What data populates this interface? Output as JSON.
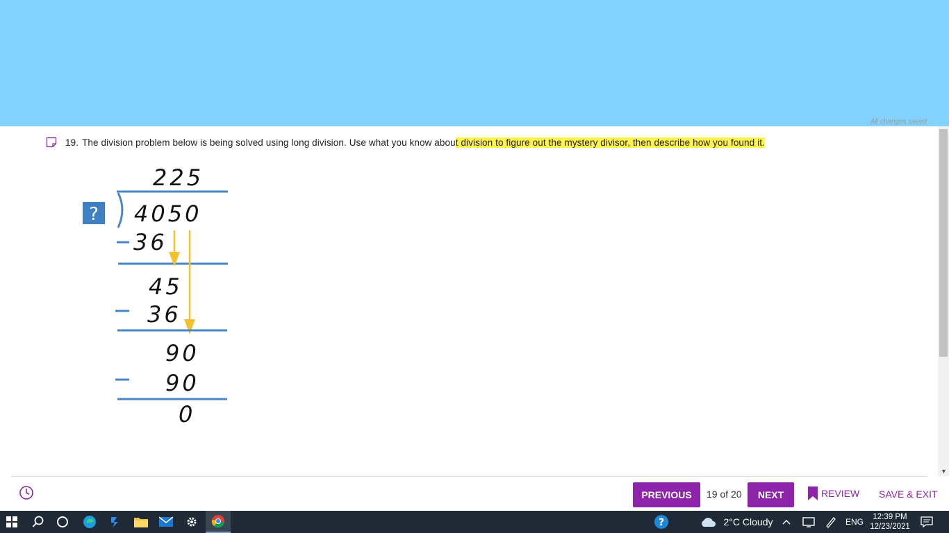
{
  "status": {
    "saved_text": "All changes saved"
  },
  "question": {
    "number": "19.",
    "text_before": "The division problem below is being solved using long division. Use what you know abou",
    "text_highlighted": "t division to figure out the mystery divisor, then describe how you found it."
  },
  "division": {
    "quotient": "225",
    "divisor": "?",
    "dividend": "4050",
    "steps": [
      {
        "subtract": "36",
        "remainder": "45"
      },
      {
        "subtract": "36",
        "remainder": "90"
      },
      {
        "subtract": "90",
        "remainder": "0"
      }
    ],
    "colors": {
      "lines": "#4a86c5",
      "arrows": "#f2c12e",
      "divisor_box": "#3f7fc4"
    }
  },
  "footer": {
    "previous_label": "PREVIOUS",
    "page_indicator": "19 of 20",
    "next_label": "NEXT",
    "review_label": "REVIEW",
    "save_exit_label": "SAVE & EXIT",
    "accent_color": "#8e24aa"
  },
  "taskbar": {
    "weather": "2°C  Cloudy",
    "language": "ENG",
    "time": "12:39 PM",
    "date": "12/23/2021",
    "icons": [
      "windows-start-icon",
      "search-icon",
      "cortana-icon",
      "edge-icon",
      "power-automate-icon",
      "file-explorer-icon",
      "mail-icon",
      "settings-icon",
      "chrome-icon",
      "help-icon",
      "cloud-icon",
      "chevron-up-icon",
      "display-icon",
      "pen-icon",
      "notification-icon"
    ]
  }
}
